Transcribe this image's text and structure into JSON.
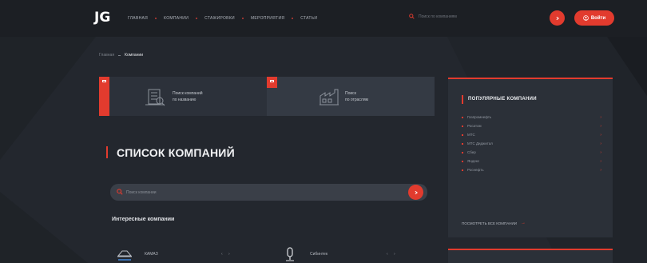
{
  "header": {
    "logo": "JG",
    "nav": [
      "Главная",
      "Компании",
      "Стажировки",
      "Мероприятия",
      "Статьи"
    ],
    "search_placeholder": "Поиск по компаниям",
    "login_label": "Войти"
  },
  "breadcrumb": {
    "home": "Главная",
    "current": "Компании"
  },
  "cards": [
    {
      "line1": "Поиск компаний",
      "line2": "по названию"
    },
    {
      "line1": "Поиск",
      "line2": "по отраслям"
    }
  ],
  "main": {
    "title": "СПИСОК КОМПАНИЙ",
    "search_placeholder": "Поиск компании",
    "section_title": "Интересные компании",
    "companies": [
      {
        "name": "КАМАЗ",
        "arrows": "‹ ›"
      },
      {
        "name": "Сибинтек",
        "arrows": "‹ ›"
      }
    ]
  },
  "sidebar": {
    "title": "ПОПУЛЯРНЫЕ КОМПАНИИ",
    "items": [
      "Газпромнефть",
      "Росатом",
      "МТС",
      "МТС Диджитал",
      "Сбер",
      "Яндекс",
      "Роснефть"
    ],
    "all_link": "ПОСМОТРЕТЬ ВСЕ КОМПАНИИ"
  },
  "colors": {
    "accent": "#e23b2e",
    "background": "#23272e",
    "header": "#1c1f24",
    "card": "#2c313a",
    "sidebar": "#2b3038"
  },
  "icons": [
    "search-icon",
    "user-icon",
    "building-icon",
    "factory-icon",
    "truck-logo-icon",
    "mic-logo-icon",
    "chevron-right-icon"
  ]
}
